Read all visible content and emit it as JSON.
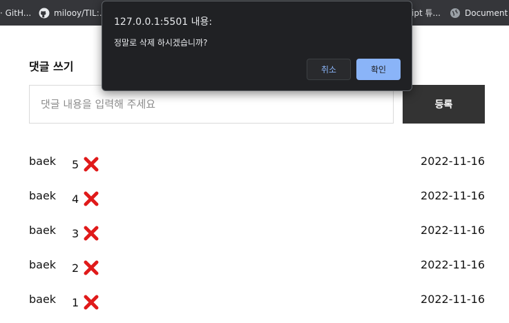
{
  "bookmarks": [
    {
      "label": "· GitH...",
      "icon": "github-icon"
    },
    {
      "label": "milooy/TIL:...",
      "icon": "github-icon"
    },
    {
      "label": "ipt 튜...",
      "icon": "bookmark-icon"
    },
    {
      "label": "Document",
      "icon": "globe-icon"
    }
  ],
  "page": {
    "section_title": "댓글 쓰기",
    "input_placeholder": "댓글 내용을 입력해 주세요",
    "input_value": "",
    "submit_label": "등록"
  },
  "comments": [
    {
      "author": "baek",
      "number": "5",
      "date": "2022-11-16"
    },
    {
      "author": "baek",
      "number": "4",
      "date": "2022-11-16"
    },
    {
      "author": "baek",
      "number": "3",
      "date": "2022-11-16"
    },
    {
      "author": "baek",
      "number": "2",
      "date": "2022-11-16"
    },
    {
      "author": "baek",
      "number": "1",
      "date": "2022-11-16"
    }
  ],
  "dialog": {
    "origin": "127.0.0.1:5501 내용:",
    "message": "정말로 삭제 하시겠습니까?",
    "cancel_label": "취소",
    "confirm_label": "확인"
  },
  "colors": {
    "bookmarks_bar": "#35363a",
    "submit_button": "#333333",
    "delete_icon": "#e01a1a",
    "dialog_background": "#202124",
    "dialog_accent": "#8ab4f8"
  }
}
